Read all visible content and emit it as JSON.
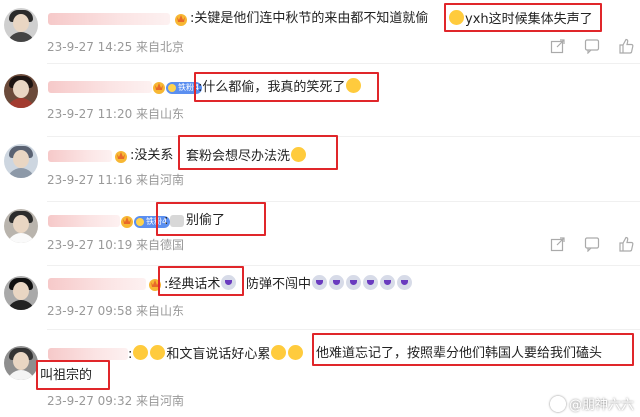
{
  "comments": [
    {
      "text_a": ":关键是他们连中秋节的来由都不知道就偷",
      "text_b": "yxh这时候集体失声了",
      "meta": "23-9-27 14:25 来自北京"
    },
    {
      "badge": "铁粉4",
      "text_a": ":什么都偷，我真的笑死了",
      "meta": "23-9-27 11:20 来自山东"
    },
    {
      "text_a": ":没关系",
      "text_b": "套粉会想尽办法洗",
      "meta": "23-9-27 11:16 来自河南"
    },
    {
      "badge": "铁粉4",
      "text_a": ":",
      "text_b": "别偷了",
      "meta": "23-9-27 10:19 来自德国"
    },
    {
      "text_a": ":经典话术",
      "text_b": "防弹不闯中",
      "meta": "23-9-27 09:58 来自山东"
    },
    {
      "text_a": ":",
      "text_b": "和文盲说话好心累",
      "text_c": "他难道忘记了，按照辈分他们韩国人要给我们磕头",
      "text_d": "叫祖宗的",
      "meta": "23-9-27 09:32 来自河南"
    }
  ],
  "watermark": "@朋神六六"
}
